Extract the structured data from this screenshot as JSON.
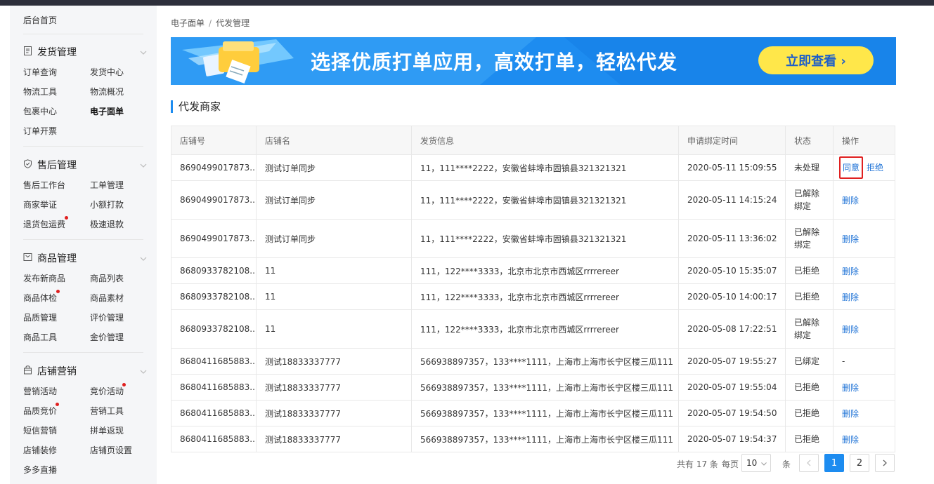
{
  "sidebar": {
    "home": "后台首页",
    "sections": [
      {
        "title": "发货管理",
        "icon": "document-icon",
        "links": [
          "订单查询",
          "发货中心",
          "物流工具",
          "物流概况",
          "包裹中心",
          "电子面单",
          "订单开票"
        ]
      },
      {
        "title": "售后管理",
        "icon": "shield-icon",
        "links": [
          "售后工作台",
          "工单管理",
          "商家举证",
          "小额打款",
          "退货包运费",
          "极速退款"
        ]
      },
      {
        "title": "商品管理",
        "icon": "box-icon",
        "links": [
          "发布新商品",
          "商品列表",
          "商品体检",
          "商品素材",
          "品质管理",
          "评价管理",
          "商品工具",
          "金价管理"
        ]
      },
      {
        "title": "店铺营销",
        "icon": "shop-icon",
        "links": [
          "营销活动",
          "竞价活动",
          "品质竞价",
          "营销工具",
          "短信营销",
          "拼单返现",
          "店铺装修",
          "店铺页设置",
          "多多直播"
        ]
      }
    ],
    "active_link": "电子面单"
  },
  "breadcrumb": {
    "items": [
      "电子面单",
      "代发管理"
    ],
    "separator": "/"
  },
  "banner": {
    "text": "选择优质打单应用，高效打单，轻松代发",
    "button": "立即查看 ›"
  },
  "section_title": "代发商家",
  "table": {
    "headers": [
      "店铺号",
      "店铺名",
      "发货信息",
      "申请绑定时间",
      "状态",
      "操作"
    ],
    "rows": [
      {
        "shop_id": "8690499017873...",
        "shop_name": "测试订单同步",
        "ship_info": "11，111****2222，安徽省蚌埠市固镇县321321321",
        "time": "2020-05-11 15:09:55",
        "status": "未处理",
        "ops": [
          "同意",
          "拒绝"
        ]
      },
      {
        "shop_id": "8690499017873...",
        "shop_name": "测试订单同步",
        "ship_info": "11，111****2222，安徽省蚌埠市固镇县321321321",
        "time": "2020-05-11 14:15:24",
        "status": "已解除绑定",
        "ops": [
          "删除"
        ]
      },
      {
        "shop_id": "8690499017873...",
        "shop_name": "测试订单同步",
        "ship_info": "11，111****2222，安徽省蚌埠市固镇县321321321",
        "time": "2020-05-11 13:36:02",
        "status": "已解除绑定",
        "ops": [
          "删除"
        ]
      },
      {
        "shop_id": "8680933782108...",
        "shop_name": "11",
        "ship_info": "111，122****3333，北京市北京市西城区rrrrereer",
        "time": "2020-05-10 15:35:07",
        "status": "已拒绝",
        "ops": [
          "删除"
        ]
      },
      {
        "shop_id": "8680933782108...",
        "shop_name": "11",
        "ship_info": "111，122****3333，北京市北京市西城区rrrrereer",
        "time": "2020-05-10 14:00:17",
        "status": "已拒绝",
        "ops": [
          "删除"
        ]
      },
      {
        "shop_id": "8680933782108...",
        "shop_name": "11",
        "ship_info": "111，122****3333，北京市北京市西城区rrrrereer",
        "time": "2020-05-08 17:22:51",
        "status": "已解除绑定",
        "ops": [
          "删除"
        ]
      },
      {
        "shop_id": "8680411685883...",
        "shop_name": "测试18833337777",
        "ship_info": "566938897357，133****1111，上海市上海市长宁区楼三瓜111",
        "time": "2020-05-07 19:55:27",
        "status": "已绑定",
        "ops": [
          "-"
        ]
      },
      {
        "shop_id": "8680411685883...",
        "shop_name": "测试18833337777",
        "ship_info": "566938897357，133****1111，上海市上海市长宁区楼三瓜111",
        "time": "2020-05-07 19:55:04",
        "status": "已拒绝",
        "ops": [
          "删除"
        ]
      },
      {
        "shop_id": "8680411685883...",
        "shop_name": "测试18833337777",
        "ship_info": "566938897357，133****1111，上海市上海市长宁区楼三瓜111",
        "time": "2020-05-07 19:54:50",
        "status": "已拒绝",
        "ops": [
          "删除"
        ]
      },
      {
        "shop_id": "8680411685883...",
        "shop_name": "测试18833337777",
        "ship_info": "566938897357，133****1111，上海市上海市长宁区楼三瓜111",
        "time": "2020-05-07 19:54:37",
        "status": "已拒绝",
        "ops": [
          "删除"
        ]
      }
    ]
  },
  "pagination": {
    "total_text": "共有 17 条",
    "per_page_label": "每页",
    "per_page_value": "10",
    "unit": "条",
    "pages": [
      "1",
      "2"
    ],
    "current": "1"
  },
  "colors": {
    "accent": "#1d8cf0",
    "highlight_border": "#e02020",
    "banner_button": "#ffe74a"
  }
}
